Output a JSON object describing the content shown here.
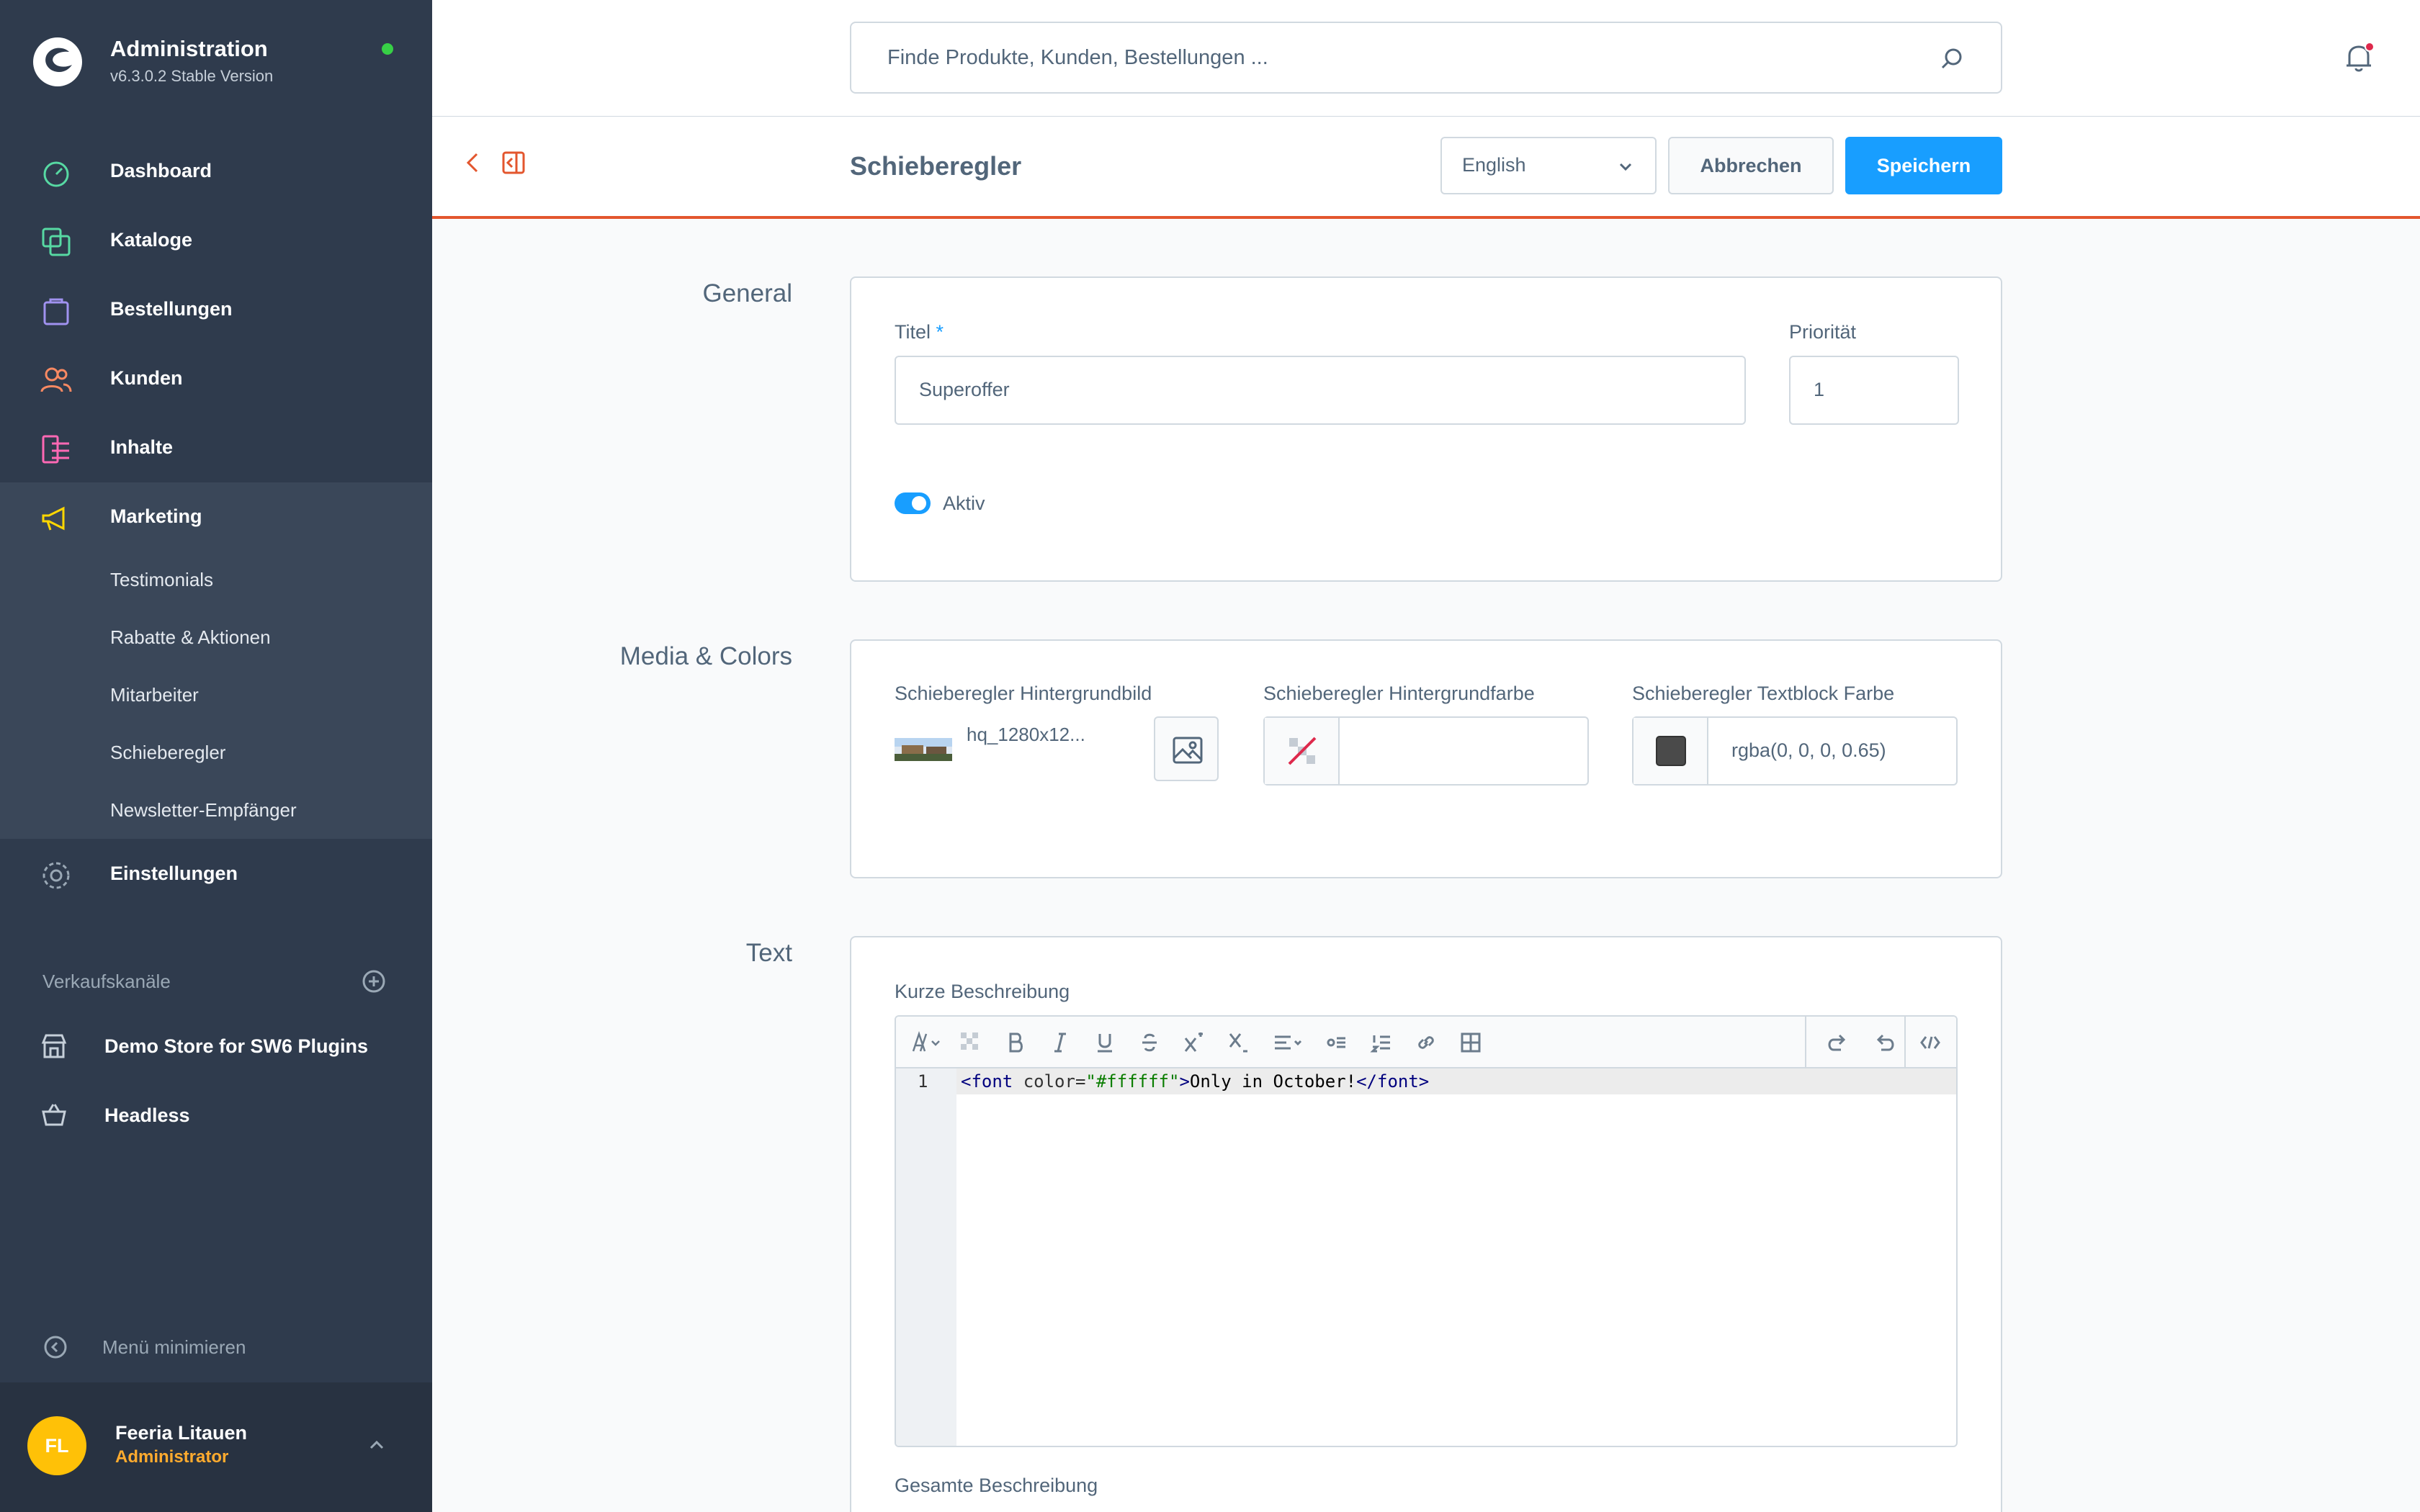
{
  "app": {
    "title": "Administration",
    "version": "v6.3.0.2 Stable Version"
  },
  "nav": {
    "items": [
      {
        "label": "Dashboard",
        "icon": "dashboard-icon",
        "color": "#57d9a3"
      },
      {
        "label": "Kataloge",
        "icon": "catalog-icon",
        "color": "#57d9a3"
      },
      {
        "label": "Bestellungen",
        "icon": "orders-icon",
        "color": "#a092f0"
      },
      {
        "label": "Kunden",
        "icon": "customers-icon",
        "color": "#f88962"
      },
      {
        "label": "Inhalte",
        "icon": "content-icon",
        "color": "#ff68b4"
      },
      {
        "label": "Marketing",
        "icon": "marketing-icon",
        "color": "#ffd700"
      }
    ],
    "marketing_sub": [
      "Testimonials",
      "Rabatte & Aktionen",
      "Mitarbeiter",
      "Schieberegler",
      "Newsletter-Empfänger"
    ],
    "settings_label": "Einstellungen"
  },
  "channels": {
    "title": "Verkaufskanäle",
    "items": [
      "Demo Store for SW6 Plugins",
      "Headless"
    ]
  },
  "minimize_label": "Menü minimieren",
  "user": {
    "initials": "FL",
    "name": "Feeria Litauen",
    "role": "Administrator"
  },
  "search": {
    "placeholder": "Finde Produkte, Kunden, Bestellungen ..."
  },
  "smartbar": {
    "title": "Schieberegler",
    "language": "English",
    "cancel_label": "Abbrechen",
    "save_label": "Speichern"
  },
  "general": {
    "section_label": "General",
    "title_label": "Titel",
    "title_required": "*",
    "title_value": "Superoffer",
    "priority_label": "Priorität",
    "priority_value": "1",
    "active_label": "Aktiv",
    "active": true
  },
  "media": {
    "section_label": "Media & Colors",
    "bg_image_label": "Schieberegler Hintergrundbild",
    "bg_image_name": "hq_1280x12...",
    "bg_color_label": "Schieberegler Hintergrundfarbe",
    "bg_color_value": "",
    "text_color_label": "Schieberegler Textblock Farbe",
    "text_color_value": "rgba(0, 0, 0, 0.65)"
  },
  "text": {
    "section_label": "Text",
    "short_desc_label": "Kurze Beschreibung",
    "line_number": "1",
    "code_open": "<font",
    "code_attr": " color=",
    "code_str": "\"#ffffff\"",
    "code_gt": ">",
    "code_text": "Only in October!",
    "code_close": "</font>",
    "full_desc_label": "Gesamte Beschreibung"
  },
  "colors": {
    "sidebar": "#2f3b4d",
    "accent": "#189eff",
    "smartbar_border": "#e3562e"
  }
}
